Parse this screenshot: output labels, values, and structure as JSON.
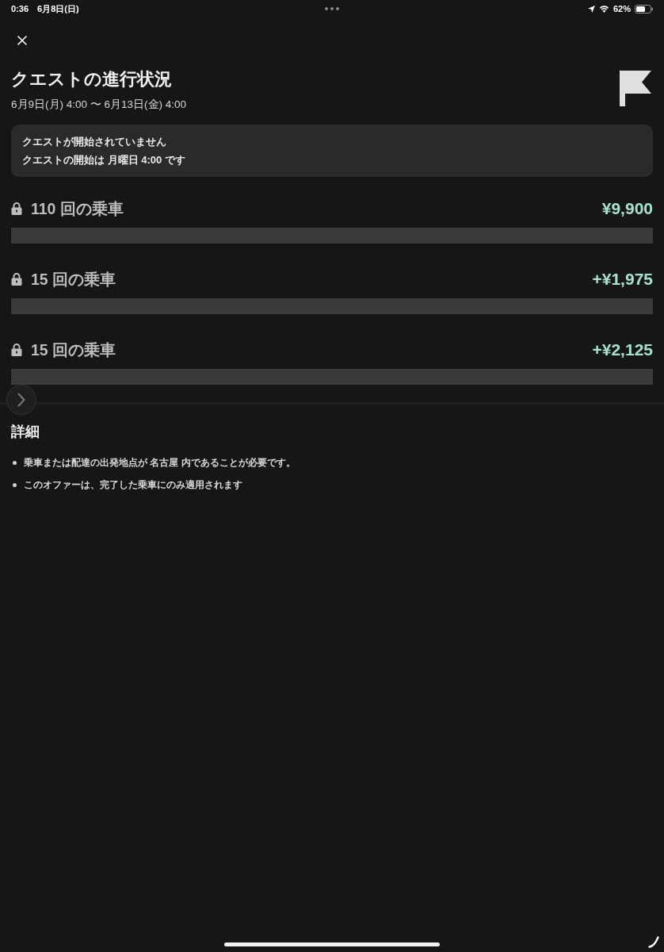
{
  "status_bar": {
    "time": "0:36",
    "date": "6月8日(日)",
    "battery": "62%"
  },
  "header": {
    "title": "クエストの進行状況",
    "date_range": "6月9日(月) 4:00 〜 6月13日(金) 4:00"
  },
  "notice": {
    "lines": [
      "クエストが開始されていません",
      "クエストの開始は 月曜日 4:00 です"
    ]
  },
  "tiers": [
    {
      "label": "110 回の乗車",
      "reward": "¥9,900",
      "locked": true
    },
    {
      "label": "15 回の乗車",
      "reward": "+¥1,975",
      "locked": true
    },
    {
      "label": "15 回の乗車",
      "reward": "+¥2,125",
      "locked": true
    }
  ],
  "details": {
    "heading": "詳細",
    "items": [
      "乗車または配達の出発地点が 名古屋 内であることが必要です。",
      "このオファーは、完了した乗車にのみ適用されます"
    ]
  }
}
